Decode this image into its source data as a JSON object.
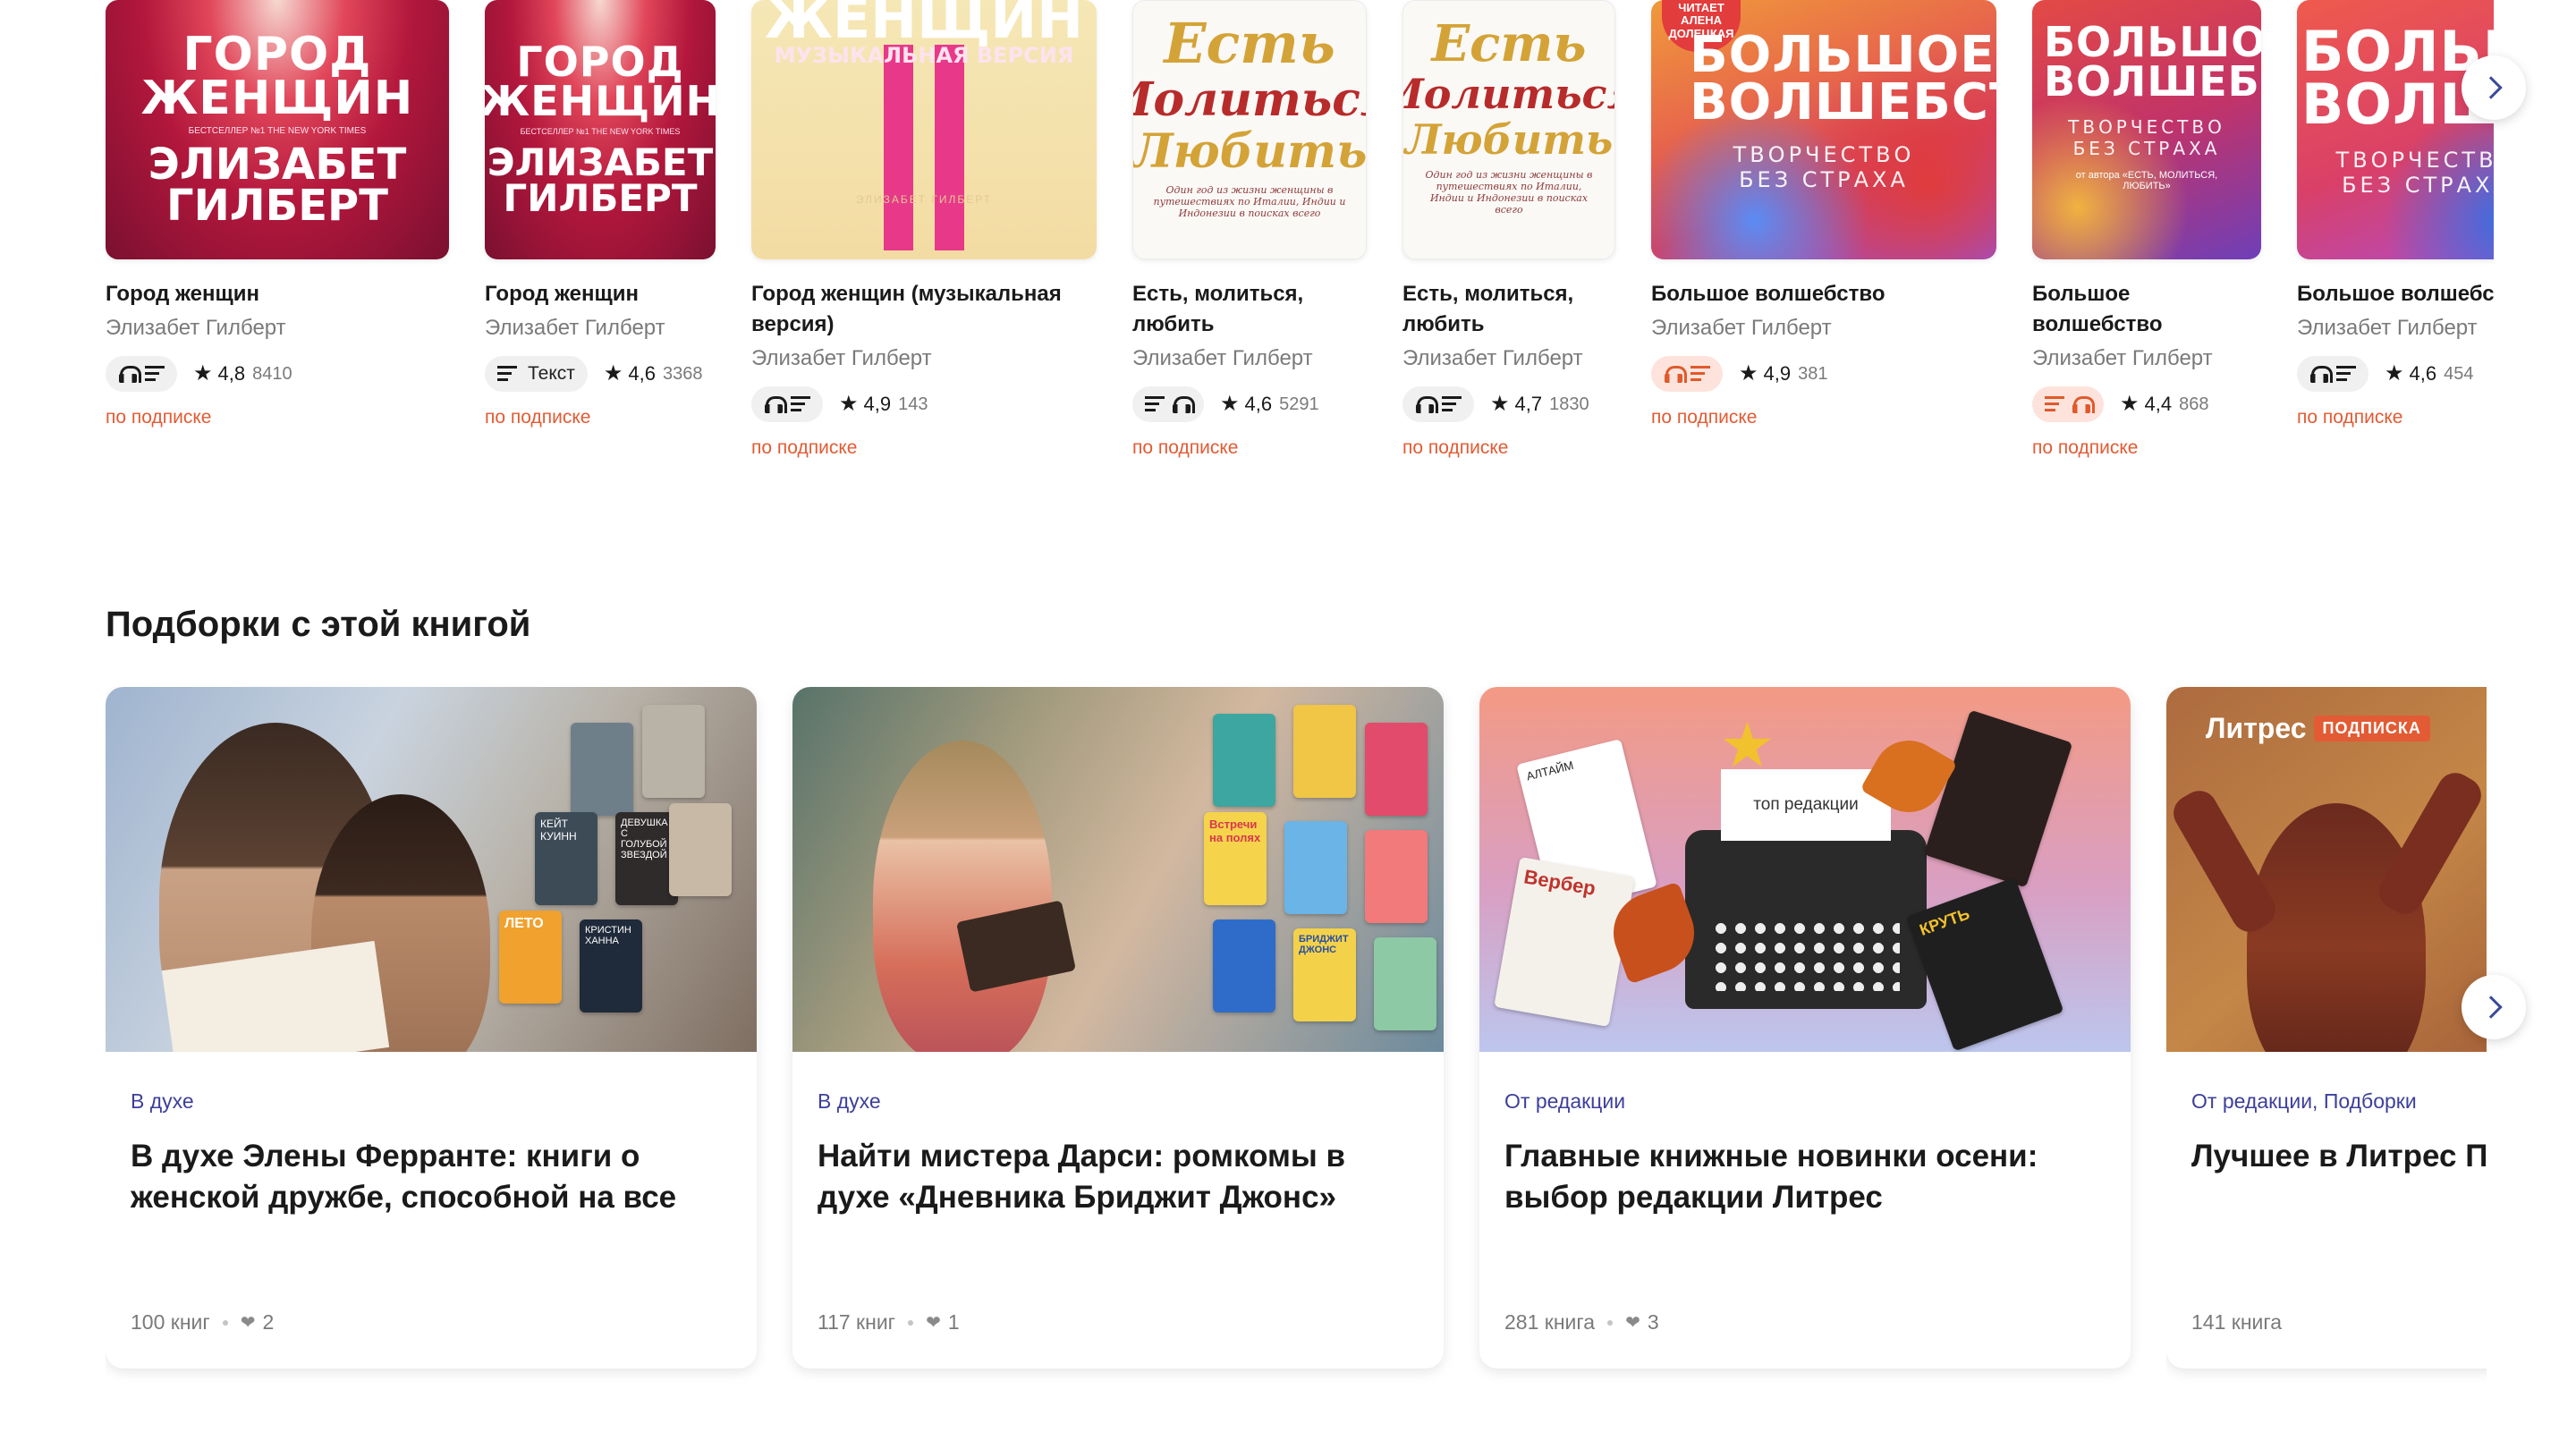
{
  "books": [
    {
      "title": "Город женщин",
      "author": "Элизабет Гилберт",
      "format_text": "",
      "format_icons": [
        "headphones",
        "text"
      ],
      "format_style": "grey",
      "rating": "4,8",
      "count": "8410",
      "subscription": "по подписке",
      "cover": {
        "title": "ГОРОД ЖЕНЩИН",
        "author": "ЭЛИЗАБЕТ ГИЛБЕРТ",
        "note": "БЕСТСЕЛЛЕР №1 THE NEW YORK TIMES"
      }
    },
    {
      "title": "Город женщин",
      "author": "Элизабет Гилберт",
      "format_text": "Текст",
      "format_icons": [
        "text"
      ],
      "format_style": "grey",
      "rating": "4,6",
      "count": "3368",
      "subscription": "по подписке",
      "cover": {
        "title": "ГОРОД ЖЕНЩИН",
        "author": "ЭЛИЗАБЕТ ГИЛБЕРТ",
        "note": "БЕСТСЕЛЛЕР №1 THE NEW YORK TIMES"
      }
    },
    {
      "title": "Город женщин (музыкальная версия)",
      "author": "Элизабет Гилберт",
      "format_text": "",
      "format_icons": [
        "headphones",
        "text"
      ],
      "format_style": "grey",
      "rating": "4,9",
      "count": "143",
      "subscription": "по подписке",
      "cover": {
        "title": "ЖЕНЩИН",
        "subtitle": "МУЗЫКАЛЬНАЯ ВЕРСИЯ",
        "author": "ЭЛИЗАБЕТ ГИЛБЕРТ"
      }
    },
    {
      "title": "Есть, молиться, любить",
      "author": "Элизабет Гилберт",
      "format_text": "",
      "format_icons": [
        "text",
        "headphones"
      ],
      "format_style": "grey",
      "rating": "4,6",
      "count": "5291",
      "subscription": "по подписке",
      "cover": {
        "w1": "Есть",
        "w2": "Молиться",
        "w3": "Любить",
        "note": "Один год из жизни женщины в путешествиях по Италии, Индии и Индонезии в поисках всего"
      }
    },
    {
      "title": "Есть, молиться, любить",
      "author": "Элизабет Гилберт",
      "format_text": "",
      "format_icons": [
        "headphones",
        "text"
      ],
      "format_style": "grey",
      "rating": "4,7",
      "count": "1830",
      "subscription": "по подписке",
      "cover": {
        "w1": "Есть",
        "w2": "Молиться",
        "w3": "Любить",
        "note": "Один год из жизни женщины в путешествиях по Италии, Индии и Индонезии в поисках всего"
      }
    },
    {
      "title": "Большое волшебство",
      "author": "Элизабет Гилберт",
      "format_text": "",
      "format_icons": [
        "headphones",
        "text"
      ],
      "format_style": "orange",
      "rating": "4,9",
      "count": "381",
      "subscription": "по подписке",
      "cover": {
        "title": "БОЛЬШОЕ ВОЛШЕБСТВО",
        "subtitle": "ТВОРЧЕСТВО БЕЗ СТРАХА",
        "badge": "ЧИТАЕТ АЛЕНА ДОЛЕЦКАЯ"
      }
    },
    {
      "title": "Большое волшебство",
      "author": "Элизабет Гилберт",
      "format_text": "",
      "format_icons": [
        "text",
        "headphones"
      ],
      "format_style": "orange",
      "rating": "4,4",
      "count": "868",
      "subscription": "по подписке",
      "cover": {
        "title": "БОЛЬШОЕ ВОЛШЕБСТВО",
        "subtitle": "ТВОРЧЕСТВО БЕЗ СТРАХА",
        "note": "от автора «ЕСТЬ, МОЛИТЬСЯ, ЛЮБИТЬ»"
      }
    },
    {
      "title": "Большое волшебство",
      "author": "Элизабет Гилберт",
      "format_text": "",
      "format_icons": [
        "headphones",
        "text"
      ],
      "format_style": "grey",
      "rating": "4,6",
      "count": "454",
      "subscription": "по подписке",
      "cover": {
        "title": "БОЛЬШОЕ ВОЛШЕБСТВО",
        "subtitle": "ТВОРЧЕСТВО БЕЗ СТРАХА"
      }
    }
  ],
  "collections_section": {
    "title": "Подборки с этой книгой"
  },
  "collections": [
    {
      "category": "В духе",
      "title": "В духе Элены Ферранте: книги о женской дружбе, способной на все",
      "books": "100 книг",
      "likes": "2",
      "image": "ferrante",
      "mini_books": [
        "КЕЙТ КУИНН",
        "ДЕВУШКА С ГОЛУБОЙ ЗВЕЗДОЙ",
        "ЛЕТО",
        "КРИСТИН ХАННА"
      ]
    },
    {
      "category": "В духе",
      "title": "Найти мистера Дарси: ромкомы в духе «Дневника Бриджит Джонс»",
      "books": "117 книг",
      "likes": "1",
      "image": "darcy",
      "mini_books": [
        "Встречи на полях",
        "БРИДЖИТ ДЖОНС"
      ]
    },
    {
      "category": "От редакции",
      "title": "Главные книжные новинки осени: выбор редакции Литрес",
      "books": "281 книга",
      "likes": "3",
      "image": "editors",
      "paper_text": "топ редакции",
      "mini_books": [
        "АЛТАЙМ",
        "Вербер",
        "КРУТЬ"
      ]
    },
    {
      "category": "От редакции, Подборки",
      "title": "Лучшее в Литрес П",
      "books": "141 книга",
      "likes": "",
      "image": "subscription",
      "logo": "Литрес",
      "logo_tag": "ПОДПИСКА"
    }
  ],
  "icons": {
    "next": "chevron-right-icon",
    "headphones": "headphones-icon",
    "text": "text-lines-icon",
    "star": "star-icon",
    "heart": "heart-icon"
  },
  "colors": {
    "accent": "#e25b34",
    "category": "#3d3f9a",
    "orange_chip": "#fde3dc"
  }
}
